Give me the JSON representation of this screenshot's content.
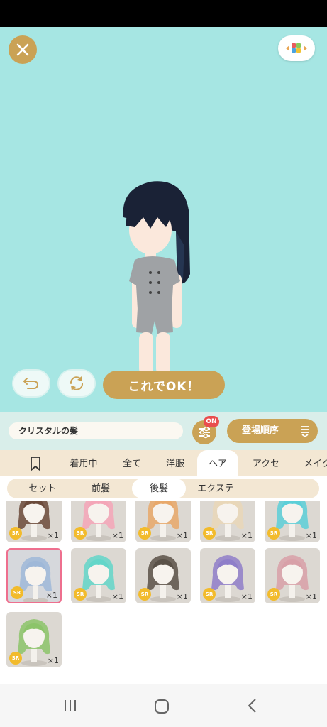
{
  "stage": {
    "ok_button": "これでOK！",
    "background": "#a6e6e3",
    "accent": "#caa255"
  },
  "toolbar": {
    "item_name": "クリスタルの髪",
    "filter_badge": "ON",
    "sort_label": "登場順序"
  },
  "tabs": [
    {
      "label": "",
      "icon": "bookmark-icon"
    },
    {
      "label": "着用中"
    },
    {
      "label": "全て"
    },
    {
      "label": "洋服"
    },
    {
      "label": "ヘア",
      "active": true
    },
    {
      "label": "アクセ"
    },
    {
      "label": "メイク"
    }
  ],
  "subtabs": [
    {
      "label": "セット"
    },
    {
      "label": "前髪"
    },
    {
      "label": "後髪",
      "active": true
    },
    {
      "label": "エクステ"
    }
  ],
  "items": [
    {
      "rarity": "SR",
      "qty": "×1",
      "hair_color": "#6b4a3a"
    },
    {
      "rarity": "SR",
      "qty": "×1",
      "hair_color": "#f4a6b8"
    },
    {
      "rarity": "SR",
      "qty": "×1",
      "hair_color": "#e8a86a"
    },
    {
      "rarity": "SR",
      "qty": "×1",
      "hair_color": "#e9d7b8"
    },
    {
      "rarity": "SR",
      "qty": "×1",
      "hair_color": "#5ccfd8"
    },
    {
      "rarity": "SR",
      "qty": "×1",
      "hair_color": "#9fb8d8",
      "selected": true
    },
    {
      "rarity": "SR",
      "qty": "×1",
      "hair_color": "#63d6c9"
    },
    {
      "rarity": "SR",
      "qty": "×1",
      "hair_color": "#5a5148"
    },
    {
      "rarity": "SR",
      "qty": "×1",
      "hair_color": "#8f7ec9"
    },
    {
      "rarity": "SR",
      "qty": "×1",
      "hair_color": "#d8a0a8"
    },
    {
      "rarity": "SR",
      "qty": "×1",
      "hair_color": "#8cc46a"
    }
  ],
  "navbar": {
    "icons": [
      "recent-apps-icon",
      "home-icon",
      "back-icon"
    ]
  }
}
